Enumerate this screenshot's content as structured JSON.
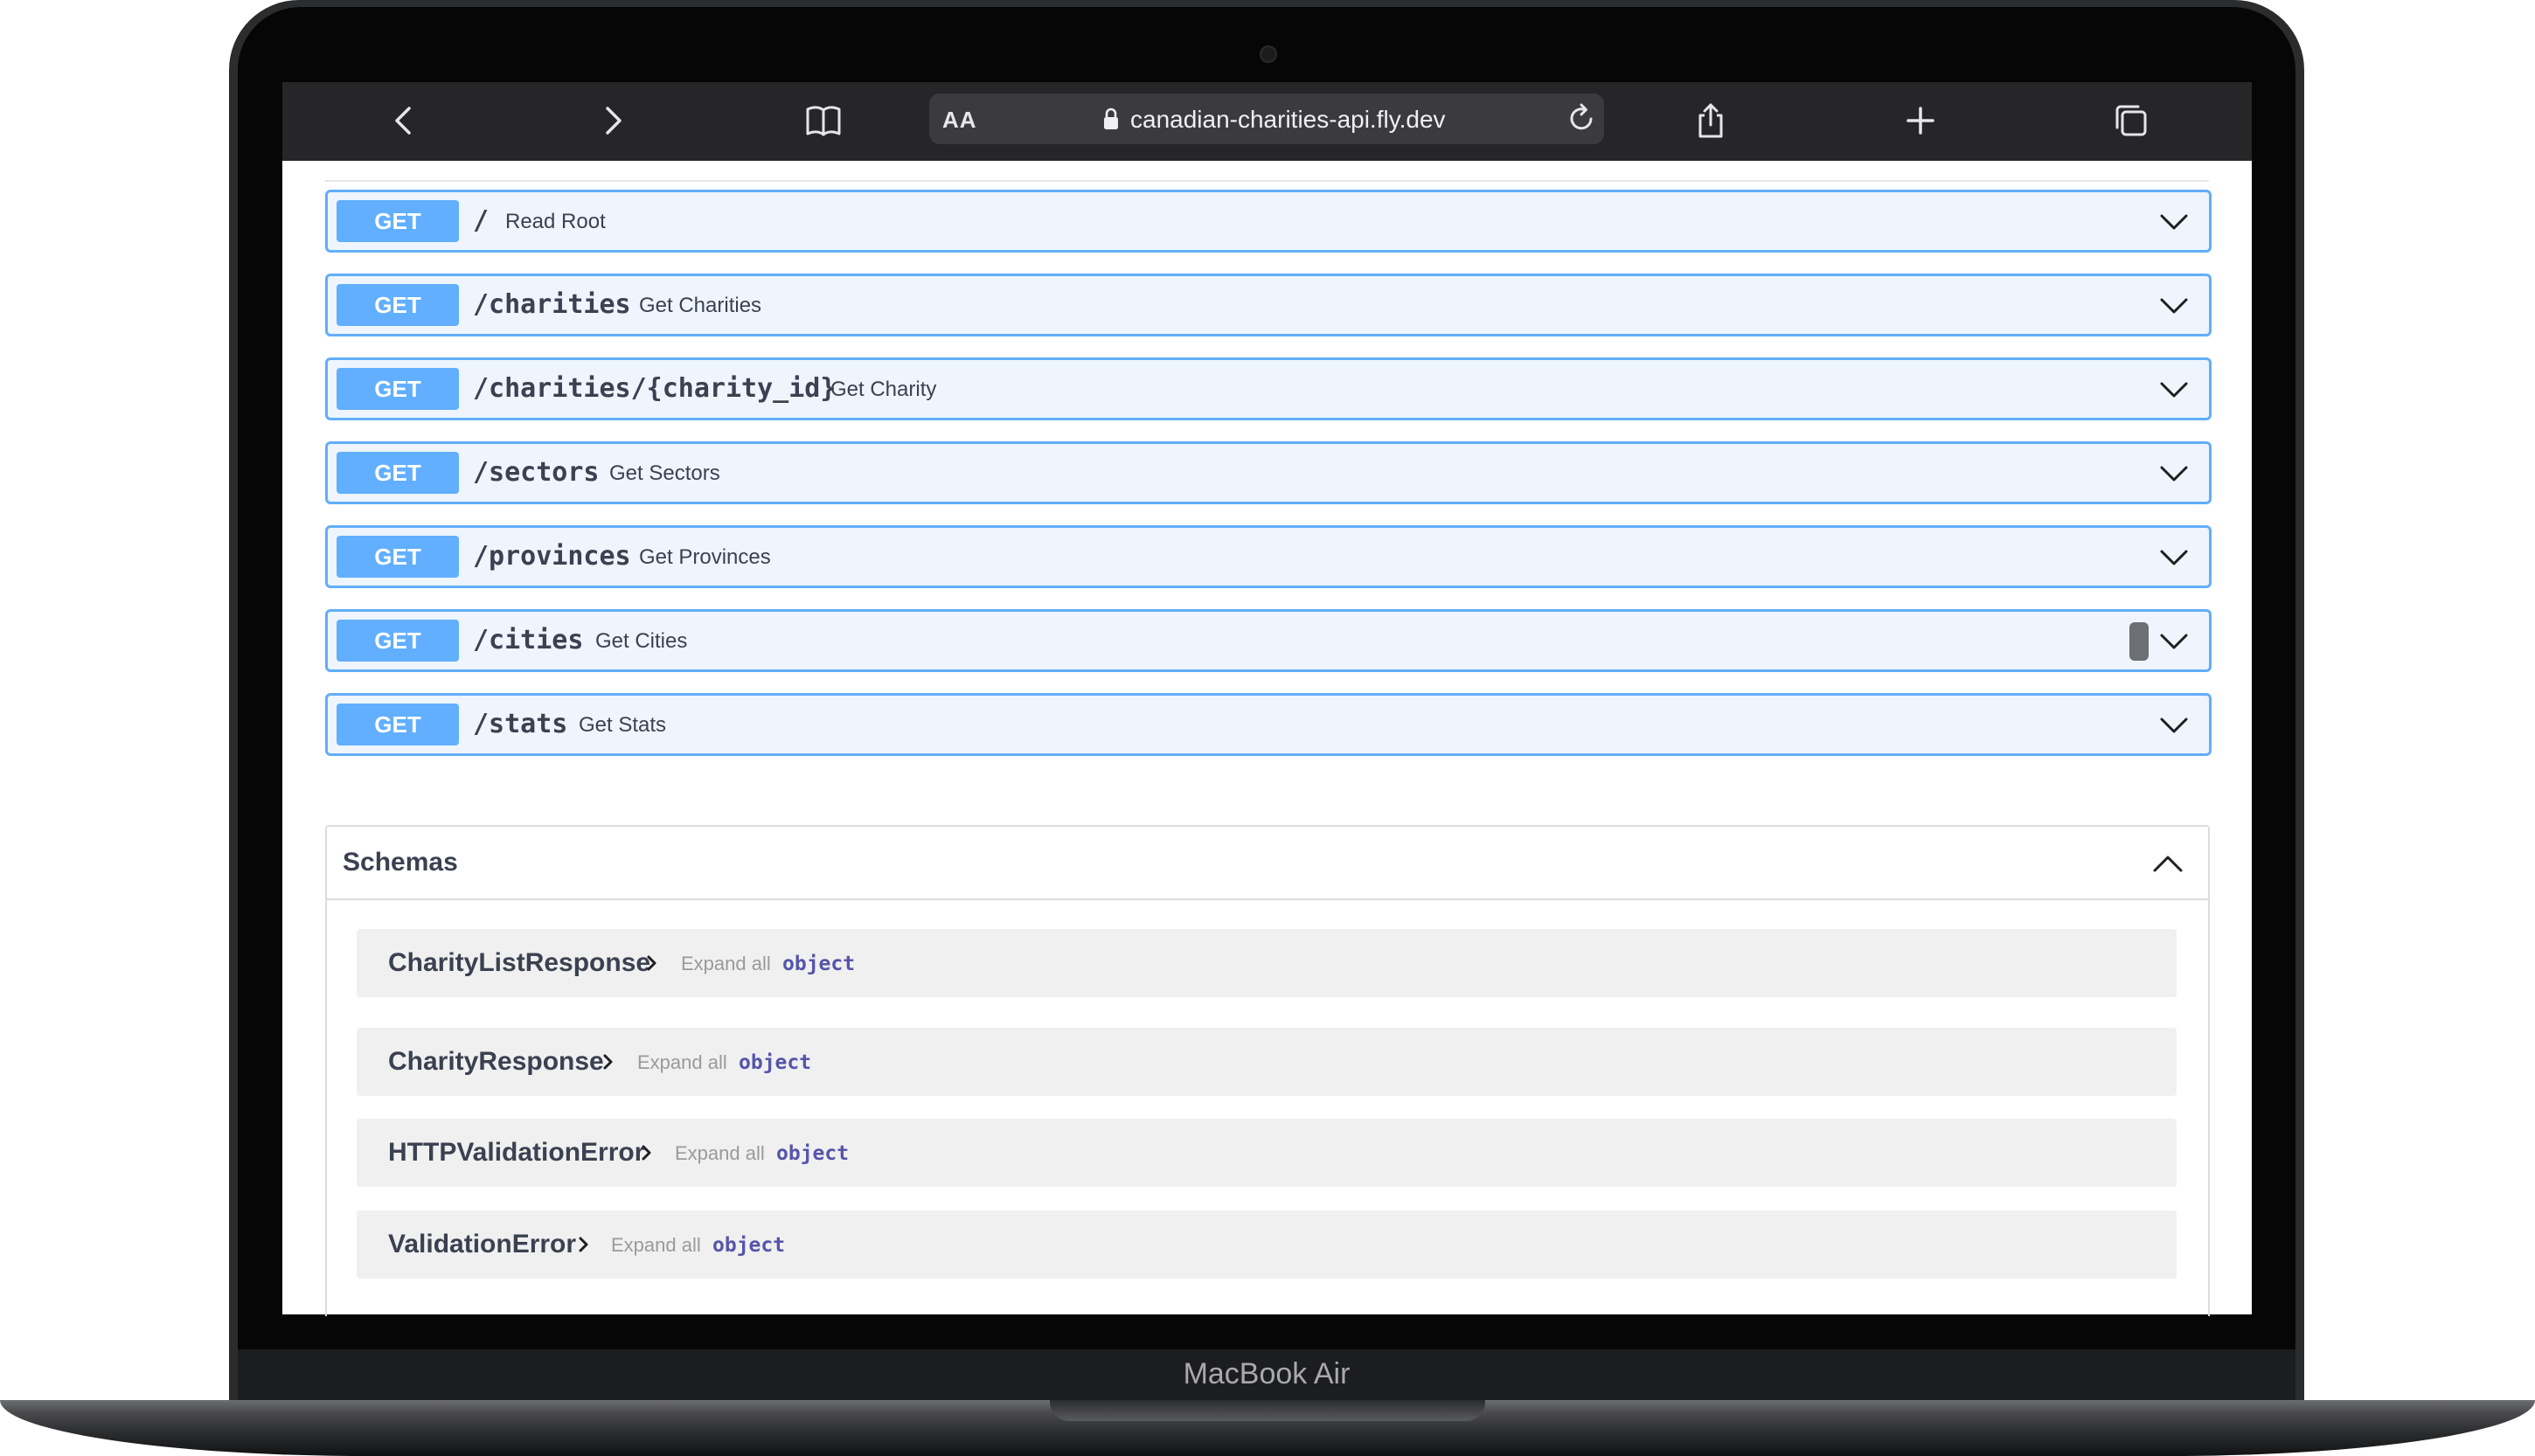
{
  "device": {
    "model_label": "MacBook Air"
  },
  "browser": {
    "aa_label": "AA",
    "url": "canadian-charities-api.fly.dev",
    "icons": {
      "back": "chevron-left-icon",
      "forward": "chevron-right-icon",
      "bookmarks": "book-icon",
      "lock": "lock-icon",
      "reload": "reload-icon",
      "share": "share-icon",
      "new_tab": "plus-icon",
      "tabs": "tabs-overview-icon"
    }
  },
  "operations": [
    {
      "method": "GET",
      "path": "/",
      "summary": "Read Root"
    },
    {
      "method": "GET",
      "path": "/charities",
      "summary": "Get Charities"
    },
    {
      "method": "GET",
      "path": "/charities/{charity_id}",
      "summary": "Get Charity"
    },
    {
      "method": "GET",
      "path": "/sectors",
      "summary": "Get Sectors"
    },
    {
      "method": "GET",
      "path": "/provinces",
      "summary": "Get Provinces"
    },
    {
      "method": "GET",
      "path": "/cities",
      "summary": "Get Cities"
    },
    {
      "method": "GET",
      "path": "/stats",
      "summary": "Get Stats"
    }
  ],
  "schemas": {
    "title": "Schemas",
    "items": [
      {
        "name": "CharityListResponse",
        "expand_label": "Expand all",
        "type": "object"
      },
      {
        "name": "CharityResponse",
        "expand_label": "Expand all",
        "type": "object"
      },
      {
        "name": "HTTPValidationError",
        "expand_label": "Expand all",
        "type": "object"
      },
      {
        "name": "ValidationError",
        "expand_label": "Expand all",
        "type": "object"
      }
    ]
  },
  "colors": {
    "get_method": "#61affe",
    "get_row_background": "#eef5fc",
    "get_row_border": "#62aefa",
    "text_primary": "#3b4151",
    "schema_type": "#5555aa"
  }
}
